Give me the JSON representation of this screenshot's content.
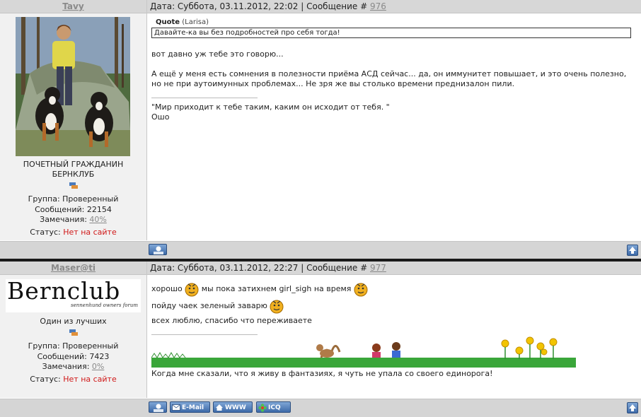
{
  "posts": [
    {
      "author": "Tavy",
      "header": {
        "date_label": "Дата: Суббота, 03.11.2012, 22:02 | Сообщение #",
        "number": "976"
      },
      "user": {
        "title_line1": "ПОЧЕТНЫЙ ГРАЖДАНИН",
        "title_line2": "БЕРНКЛУБ",
        "group": "Группа: Проверенный",
        "messages": "Сообщений: 22154",
        "warnings_label": "Замечания:",
        "warnings_value": "40%",
        "status_label": "Статус:",
        "status_value": "Нет на сайте"
      },
      "quote": {
        "label": "Quote",
        "source": "(Larisa)",
        "text": "Давайте-ка вы без подробностей про себя тогда!"
      },
      "lines": [
        "вот давно уж тебе это говорю...",
        "А ещё у меня есть сомнения в полезности приёма АСД сейчас... да, он иммунитет повышает, и это очень полезно,",
        "но не при аутоимунных проблемах... Не зря же вы столько времени преднизалон пили."
      ],
      "signature": [
        "\"Мир приходит к тебе таким, каким он исходит от тебя. \"",
        "Ошо"
      ]
    },
    {
      "author": "Maser@ti",
      "header": {
        "date_label": "Дата: Суббота, 03.11.2012, 22:27 | Сообщение #",
        "number": "977"
      },
      "logo": {
        "title": "Bernclub",
        "subtitle": "sennenhund owners forum"
      },
      "user": {
        "title_line1": "Один из лучших",
        "group": "Группа: Проверенный",
        "messages": "Сообщений: 7423",
        "warnings_label": "Замечания:",
        "warnings_value": "0%",
        "status_label": "Статус:",
        "status_value": "Нет на сайте"
      },
      "lines": {
        "l1a": "хорошо",
        "l1b": "мы пока затихнем",
        "l1c": "girl_sigh",
        "l1d": "на время",
        "l2": "пойду чаек зеленый заварю",
        "l3": "всех люблю, спасибо что переживаете"
      },
      "signature": "Когда мне сказали, что я живу в фантазиях, я чуть не упала со своего единорога!",
      "buttons": {
        "email": "E-Mail",
        "www": "WWW",
        "icq": "ICQ"
      }
    }
  ],
  "icons": [
    "profile-icon",
    "mail-icon",
    "home-icon",
    "icq-flower-icon",
    "arrow-up-icon",
    "smiley-icon",
    "rank-icon"
  ],
  "colors": {
    "header_bg": "#d7d7d7",
    "sidebar_bg": "#f1f1f1",
    "status_offline": "#d01818",
    "button_blue": "#3d6aa8"
  }
}
